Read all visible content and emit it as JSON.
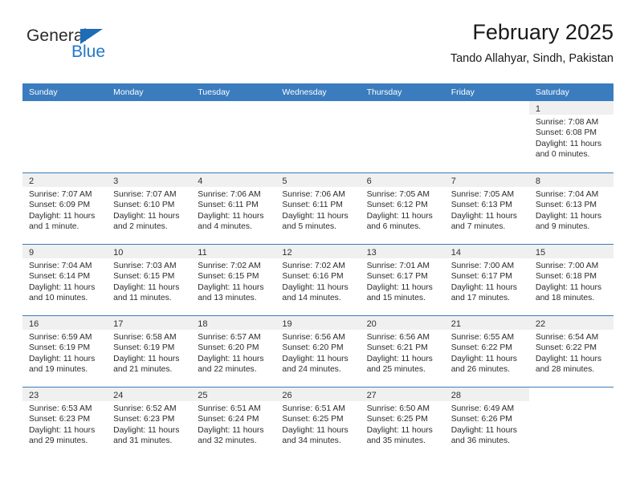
{
  "brand": {
    "word_one": "General",
    "word_two": "Blue",
    "triangle_color": "#1f6cb4",
    "blue_color": "#2277c8"
  },
  "header": {
    "title": "February 2025",
    "subtitle": "Tando Allahyar, Sindh, Pakistan"
  },
  "theme": {
    "header_bar": "#3a7cbe",
    "daynum_band": "#f0f0f0",
    "text": "#2b2b2b"
  },
  "calendar": {
    "weekdays": [
      "Sunday",
      "Monday",
      "Tuesday",
      "Wednesday",
      "Thursday",
      "Friday",
      "Saturday"
    ],
    "labels": {
      "sunrise": "Sunrise:",
      "sunset": "Sunset:",
      "daylight": "Daylight:"
    },
    "weeks": [
      [
        {
          "empty": true
        },
        {
          "empty": true
        },
        {
          "empty": true
        },
        {
          "empty": true
        },
        {
          "empty": true
        },
        {
          "empty": true
        },
        {
          "day": "1",
          "sunrise": "Sunrise: 7:08 AM",
          "sunset": "Sunset: 6:08 PM",
          "daylight": "Daylight: 11 hours and 0 minutes."
        }
      ],
      [
        {
          "day": "2",
          "sunrise": "Sunrise: 7:07 AM",
          "sunset": "Sunset: 6:09 PM",
          "daylight": "Daylight: 11 hours and 1 minute."
        },
        {
          "day": "3",
          "sunrise": "Sunrise: 7:07 AM",
          "sunset": "Sunset: 6:10 PM",
          "daylight": "Daylight: 11 hours and 2 minutes."
        },
        {
          "day": "4",
          "sunrise": "Sunrise: 7:06 AM",
          "sunset": "Sunset: 6:11 PM",
          "daylight": "Daylight: 11 hours and 4 minutes."
        },
        {
          "day": "5",
          "sunrise": "Sunrise: 7:06 AM",
          "sunset": "Sunset: 6:11 PM",
          "daylight": "Daylight: 11 hours and 5 minutes."
        },
        {
          "day": "6",
          "sunrise": "Sunrise: 7:05 AM",
          "sunset": "Sunset: 6:12 PM",
          "daylight": "Daylight: 11 hours and 6 minutes."
        },
        {
          "day": "7",
          "sunrise": "Sunrise: 7:05 AM",
          "sunset": "Sunset: 6:13 PM",
          "daylight": "Daylight: 11 hours and 7 minutes."
        },
        {
          "day": "8",
          "sunrise": "Sunrise: 7:04 AM",
          "sunset": "Sunset: 6:13 PM",
          "daylight": "Daylight: 11 hours and 9 minutes."
        }
      ],
      [
        {
          "day": "9",
          "sunrise": "Sunrise: 7:04 AM",
          "sunset": "Sunset: 6:14 PM",
          "daylight": "Daylight: 11 hours and 10 minutes."
        },
        {
          "day": "10",
          "sunrise": "Sunrise: 7:03 AM",
          "sunset": "Sunset: 6:15 PM",
          "daylight": "Daylight: 11 hours and 11 minutes."
        },
        {
          "day": "11",
          "sunrise": "Sunrise: 7:02 AM",
          "sunset": "Sunset: 6:15 PM",
          "daylight": "Daylight: 11 hours and 13 minutes."
        },
        {
          "day": "12",
          "sunrise": "Sunrise: 7:02 AM",
          "sunset": "Sunset: 6:16 PM",
          "daylight": "Daylight: 11 hours and 14 minutes."
        },
        {
          "day": "13",
          "sunrise": "Sunrise: 7:01 AM",
          "sunset": "Sunset: 6:17 PM",
          "daylight": "Daylight: 11 hours and 15 minutes."
        },
        {
          "day": "14",
          "sunrise": "Sunrise: 7:00 AM",
          "sunset": "Sunset: 6:17 PM",
          "daylight": "Daylight: 11 hours and 17 minutes."
        },
        {
          "day": "15",
          "sunrise": "Sunrise: 7:00 AM",
          "sunset": "Sunset: 6:18 PM",
          "daylight": "Daylight: 11 hours and 18 minutes."
        }
      ],
      [
        {
          "day": "16",
          "sunrise": "Sunrise: 6:59 AM",
          "sunset": "Sunset: 6:19 PM",
          "daylight": "Daylight: 11 hours and 19 minutes."
        },
        {
          "day": "17",
          "sunrise": "Sunrise: 6:58 AM",
          "sunset": "Sunset: 6:19 PM",
          "daylight": "Daylight: 11 hours and 21 minutes."
        },
        {
          "day": "18",
          "sunrise": "Sunrise: 6:57 AM",
          "sunset": "Sunset: 6:20 PM",
          "daylight": "Daylight: 11 hours and 22 minutes."
        },
        {
          "day": "19",
          "sunrise": "Sunrise: 6:56 AM",
          "sunset": "Sunset: 6:20 PM",
          "daylight": "Daylight: 11 hours and 24 minutes."
        },
        {
          "day": "20",
          "sunrise": "Sunrise: 6:56 AM",
          "sunset": "Sunset: 6:21 PM",
          "daylight": "Daylight: 11 hours and 25 minutes."
        },
        {
          "day": "21",
          "sunrise": "Sunrise: 6:55 AM",
          "sunset": "Sunset: 6:22 PM",
          "daylight": "Daylight: 11 hours and 26 minutes."
        },
        {
          "day": "22",
          "sunrise": "Sunrise: 6:54 AM",
          "sunset": "Sunset: 6:22 PM",
          "daylight": "Daylight: 11 hours and 28 minutes."
        }
      ],
      [
        {
          "day": "23",
          "sunrise": "Sunrise: 6:53 AM",
          "sunset": "Sunset: 6:23 PM",
          "daylight": "Daylight: 11 hours and 29 minutes."
        },
        {
          "day": "24",
          "sunrise": "Sunrise: 6:52 AM",
          "sunset": "Sunset: 6:23 PM",
          "daylight": "Daylight: 11 hours and 31 minutes."
        },
        {
          "day": "25",
          "sunrise": "Sunrise: 6:51 AM",
          "sunset": "Sunset: 6:24 PM",
          "daylight": "Daylight: 11 hours and 32 minutes."
        },
        {
          "day": "26",
          "sunrise": "Sunrise: 6:51 AM",
          "sunset": "Sunset: 6:25 PM",
          "daylight": "Daylight: 11 hours and 34 minutes."
        },
        {
          "day": "27",
          "sunrise": "Sunrise: 6:50 AM",
          "sunset": "Sunset: 6:25 PM",
          "daylight": "Daylight: 11 hours and 35 minutes."
        },
        {
          "day": "28",
          "sunrise": "Sunrise: 6:49 AM",
          "sunset": "Sunset: 6:26 PM",
          "daylight": "Daylight: 11 hours and 36 minutes."
        },
        {
          "empty": true
        }
      ]
    ]
  }
}
